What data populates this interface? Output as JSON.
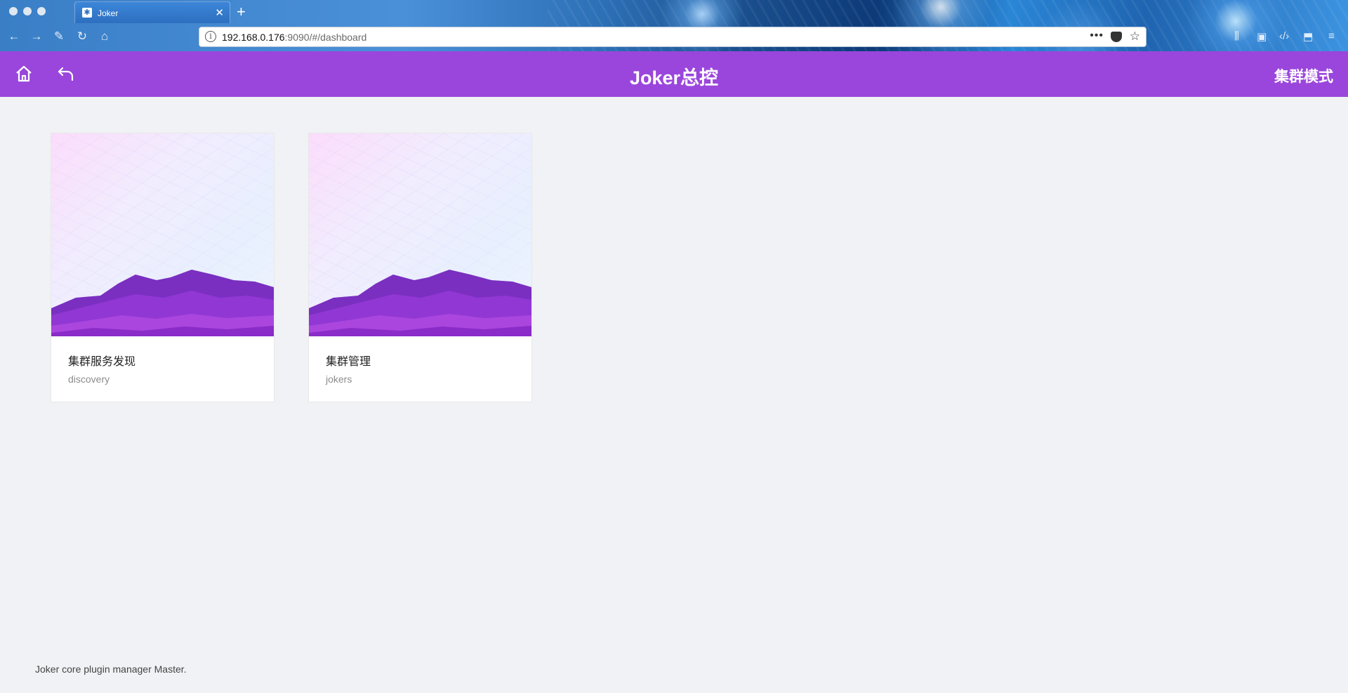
{
  "browser": {
    "tab_title": "Joker",
    "tab_favicon": "snowflake-icon",
    "url_host": "192.168.0.176",
    "url_rest": ":9090/#/dashboard",
    "nav_icons": [
      "back-arrow-icon",
      "forward-arrow-icon",
      "wrench-icon",
      "reload-icon",
      "home-icon"
    ],
    "right_icons": [
      "library-icon",
      "sidebar-icon",
      "devtools-icon",
      "extension-icon",
      "menu-icon"
    ]
  },
  "header": {
    "title": "Joker总控",
    "mode_label": "集群模式",
    "bg_color": "#9a46dc"
  },
  "cards": [
    {
      "title": "集群服务发现",
      "description": "discovery"
    },
    {
      "title": "集群管理",
      "description": "jokers"
    }
  ],
  "footer": {
    "text": "Joker core plugin manager Master."
  }
}
